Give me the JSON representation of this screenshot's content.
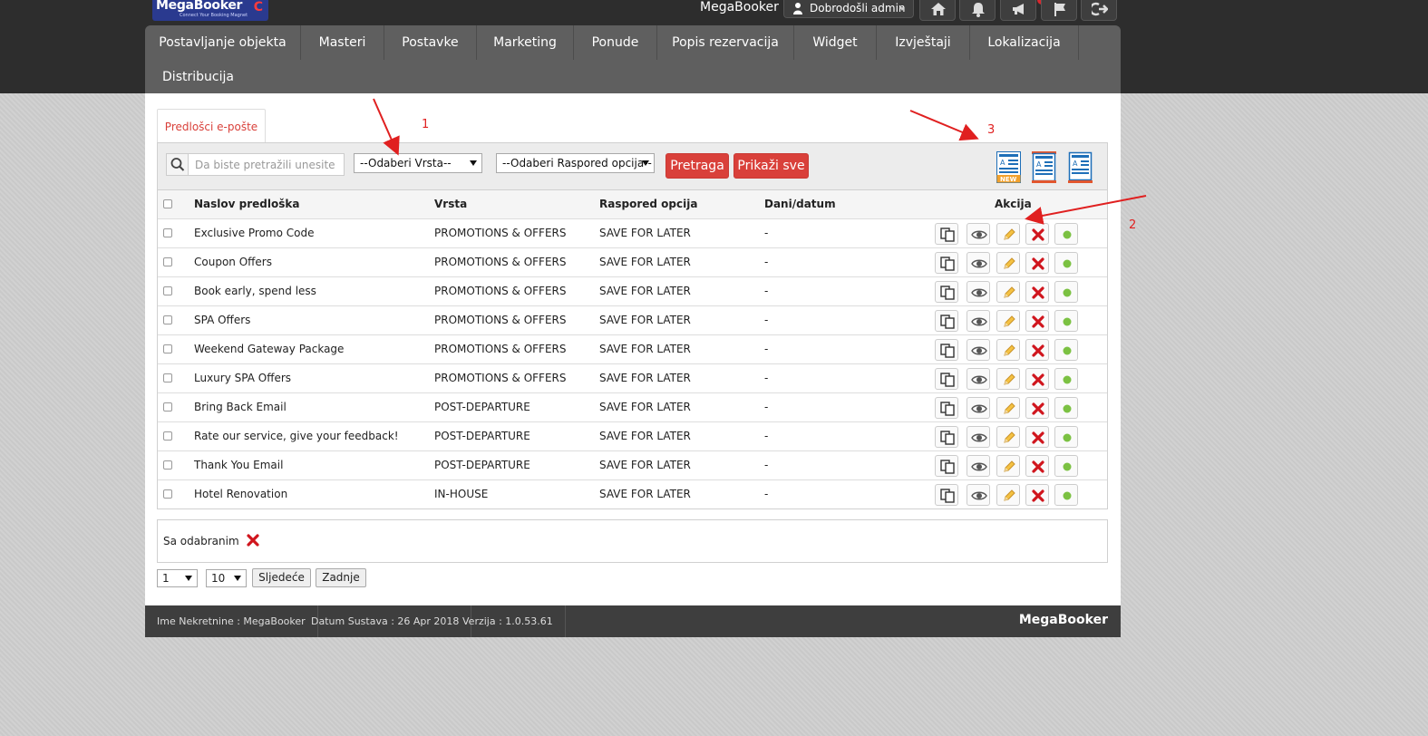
{
  "app": {
    "logo_text": "MegaBooker",
    "logo_tagline": "Connect Your Booking Magnet",
    "brand": "MegaBooker",
    "user_greeting": "Dobrodošli admin"
  },
  "nav": {
    "items": [
      "Postavljanje objekta",
      "Masteri",
      "Postavke",
      "Marketing",
      "Ponude",
      "Popis rezervacija",
      "Widget",
      "Izvještaji",
      "Lokalizacija",
      "Distribucija"
    ]
  },
  "tab": {
    "label": "Predlošci e-pošte"
  },
  "filters": {
    "search_placeholder": "Da biste pretražili unesite pojam",
    "vrsta_selected": "--Odaberi Vrsta--",
    "raspored_selected": "--Odaberi Raspored opcija--",
    "search_button": "Pretraga",
    "show_all_button": "Prikaži sve"
  },
  "table": {
    "headers": {
      "title": "Naslov predloška",
      "type": "Vrsta",
      "schedule": "Raspored opcija",
      "days": "Dani/datum",
      "action": "Akcija"
    },
    "rows": [
      {
        "title": "Exclusive Promo Code",
        "type": "PROMOTIONS & OFFERS",
        "schedule": "SAVE FOR LATER",
        "days": "-"
      },
      {
        "title": "Coupon Offers",
        "type": "PROMOTIONS & OFFERS",
        "schedule": "SAVE FOR LATER",
        "days": "-"
      },
      {
        "title": "Book early, spend less",
        "type": "PROMOTIONS & OFFERS",
        "schedule": "SAVE FOR LATER",
        "days": "-"
      },
      {
        "title": "SPA Offers",
        "type": "PROMOTIONS & OFFERS",
        "schedule": "SAVE FOR LATER",
        "days": "-"
      },
      {
        "title": "Weekend Gateway Package",
        "type": "PROMOTIONS & OFFERS",
        "schedule": "SAVE FOR LATER",
        "days": "-"
      },
      {
        "title": "Luxury SPA Offers",
        "type": "PROMOTIONS & OFFERS",
        "schedule": "SAVE FOR LATER",
        "days": "-"
      },
      {
        "title": "Bring Back Email",
        "type": "POST-DEPARTURE",
        "schedule": "SAVE FOR LATER",
        "days": "-"
      },
      {
        "title": "Rate our service, give your feedback!",
        "type": "POST-DEPARTURE",
        "schedule": "SAVE FOR LATER",
        "days": "-"
      },
      {
        "title": "Thank You Email",
        "type": "POST-DEPARTURE",
        "schedule": "SAVE FOR LATER",
        "days": "-"
      },
      {
        "title": "Hotel Renovation",
        "type": "IN-HOUSE",
        "schedule": "SAVE FOR LATER",
        "days": "-"
      }
    ]
  },
  "bulk": {
    "label": "Sa odabranim"
  },
  "pagination": {
    "page_selected": "1",
    "page_size_selected": "10",
    "next_label": "Sljedeće",
    "last_label": "Zadnje"
  },
  "footer": {
    "property": "Ime Nekretnine : MegaBooker",
    "date": "Datum Sustava : 26 Apr 2018",
    "version": "Verzija : 1.0.53.61",
    "brand": "MegaBooker"
  },
  "annotations": [
    "1",
    "2",
    "3"
  ],
  "icons": {
    "template_new_badge": "NEW",
    "template_letter": "A"
  },
  "colors": {
    "accent_red": "#d9403a",
    "topbar": "#2d2d2d",
    "navbar": "#5f5f5f",
    "delete_red": "#d0151d",
    "status_green": "#7bc142",
    "annotation_red": "#e02020"
  }
}
